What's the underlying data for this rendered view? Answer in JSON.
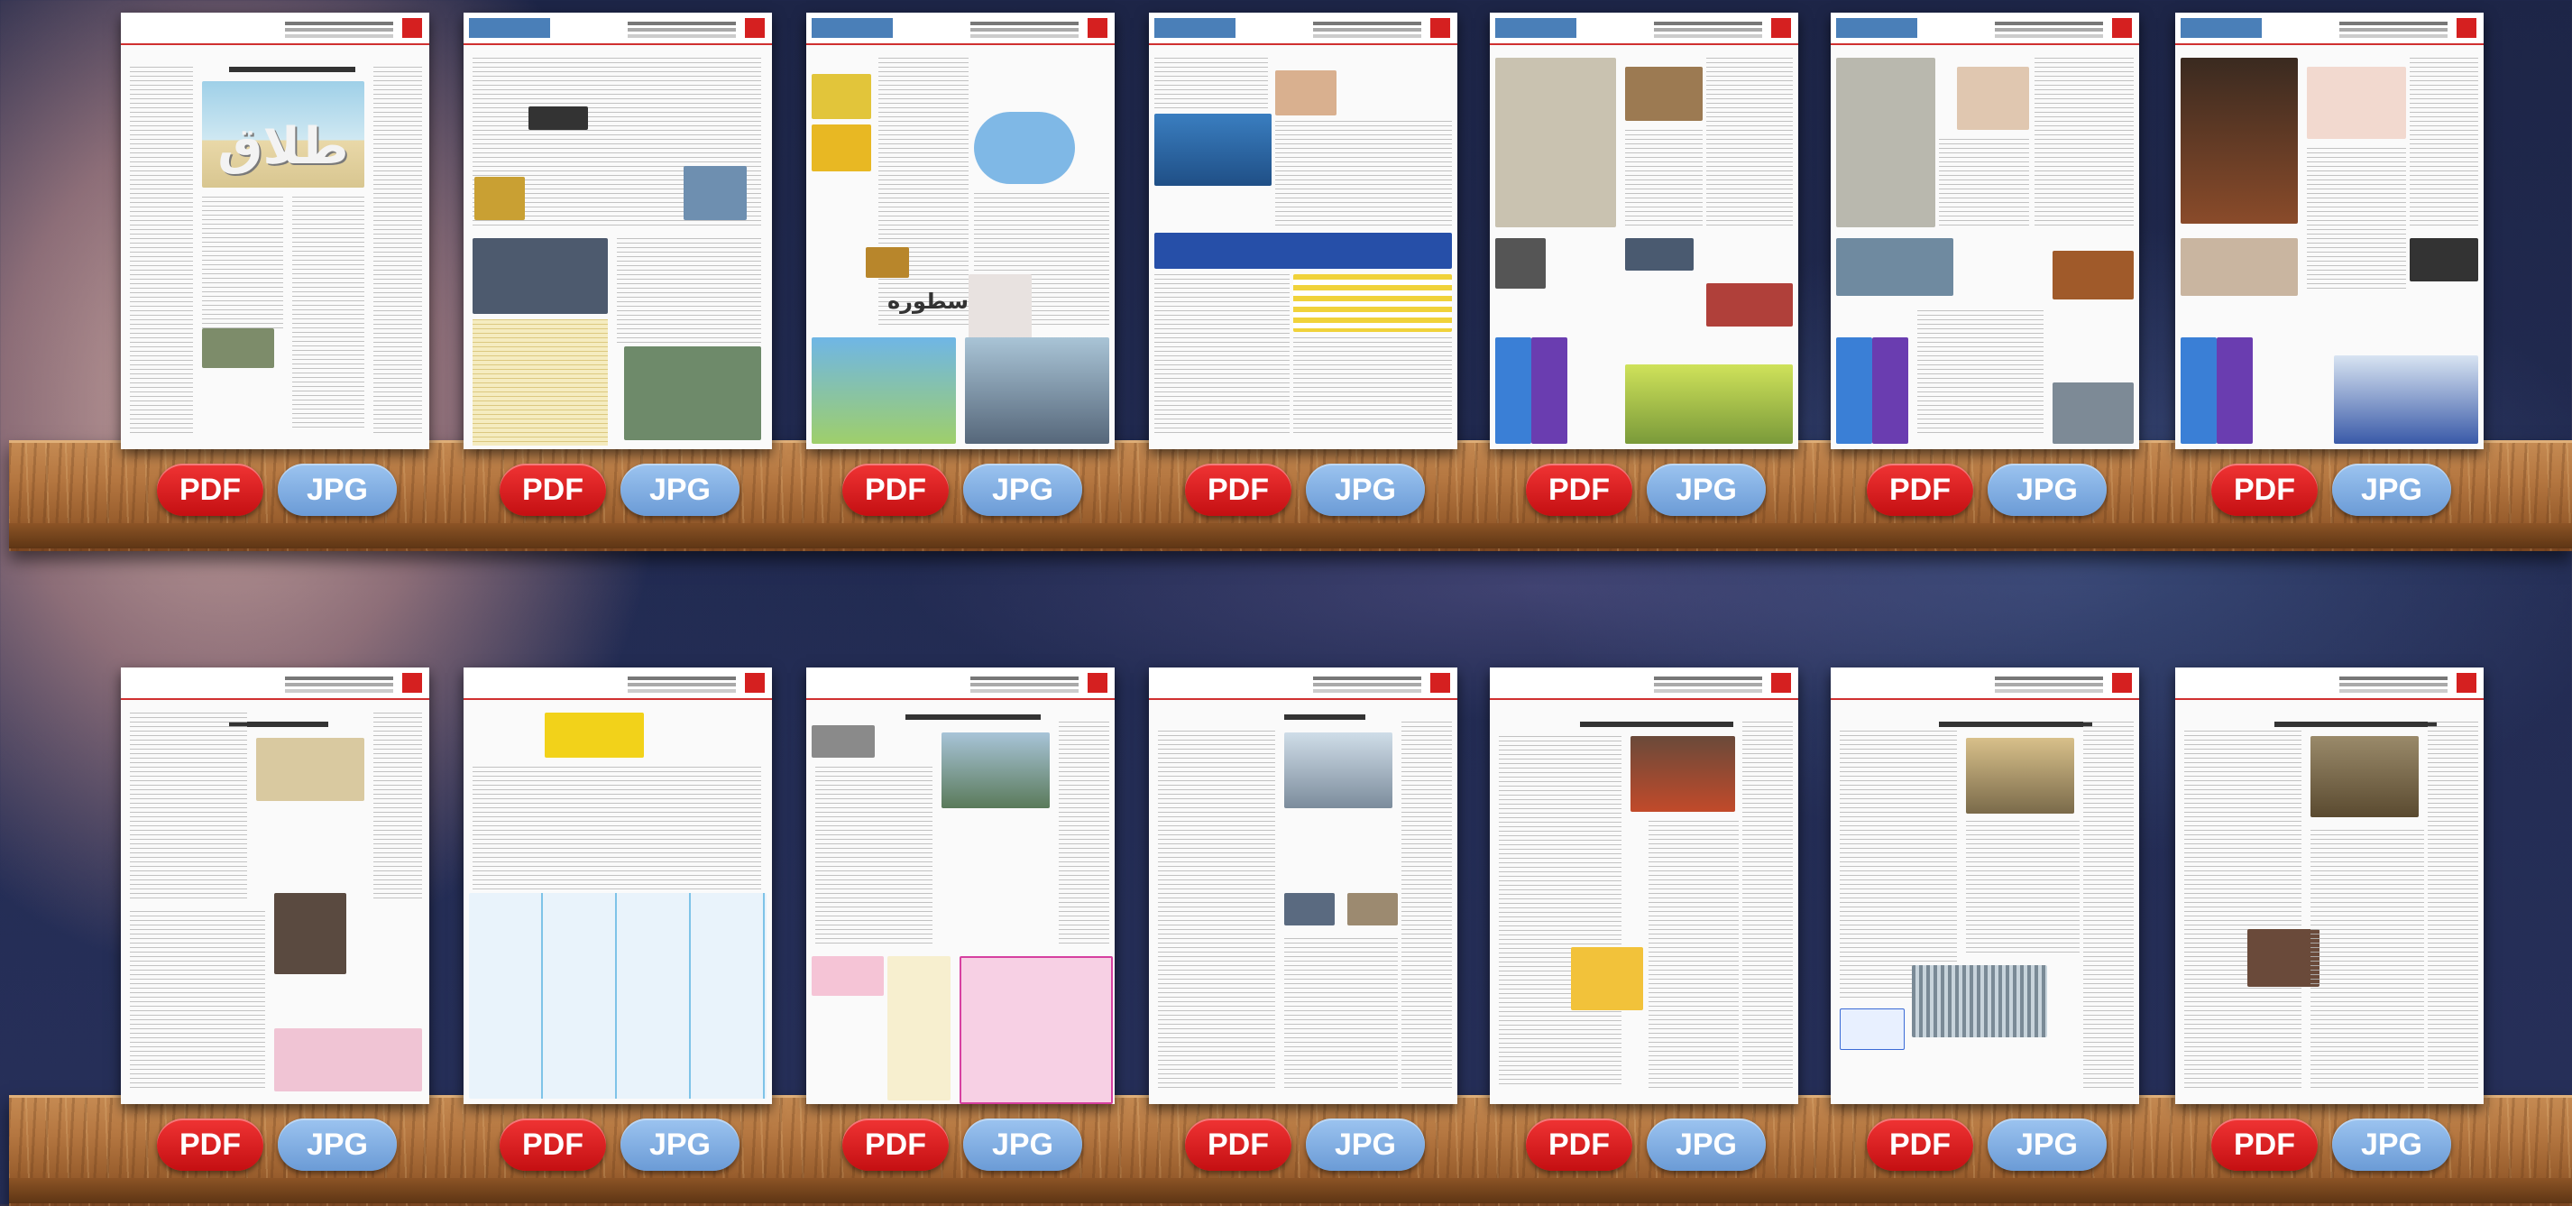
{
  "shelves": [
    {
      "items": [
        {
          "pdf_label": "PDF",
          "jpg_label": "JPG",
          "cover_word": "طلاق"
        },
        {
          "pdf_label": "PDF",
          "jpg_label": "JPG"
        },
        {
          "pdf_label": "PDF",
          "jpg_label": "JPG",
          "cover_word": "اسطوره"
        },
        {
          "pdf_label": "PDF",
          "jpg_label": "JPG"
        },
        {
          "pdf_label": "PDF",
          "jpg_label": "JPG"
        },
        {
          "pdf_label": "PDF",
          "jpg_label": "JPG"
        },
        {
          "pdf_label": "PDF",
          "jpg_label": "JPG"
        }
      ]
    },
    {
      "items": [
        {
          "pdf_label": "PDF",
          "jpg_label": "JPG"
        },
        {
          "pdf_label": "PDF",
          "jpg_label": "JPG"
        },
        {
          "pdf_label": "PDF",
          "jpg_label": "JPG"
        },
        {
          "pdf_label": "PDF",
          "jpg_label": "JPG"
        },
        {
          "pdf_label": "PDF",
          "jpg_label": "JPG"
        },
        {
          "pdf_label": "PDF",
          "jpg_label": "JPG"
        },
        {
          "pdf_label": "PDF",
          "jpg_label": "JPG"
        }
      ]
    }
  ],
  "colors": {
    "pdf_button": "#d81e22",
    "jpg_button": "#7aa7de",
    "shelf_wood": "#b47640",
    "masthead_logo": "#d52020"
  }
}
